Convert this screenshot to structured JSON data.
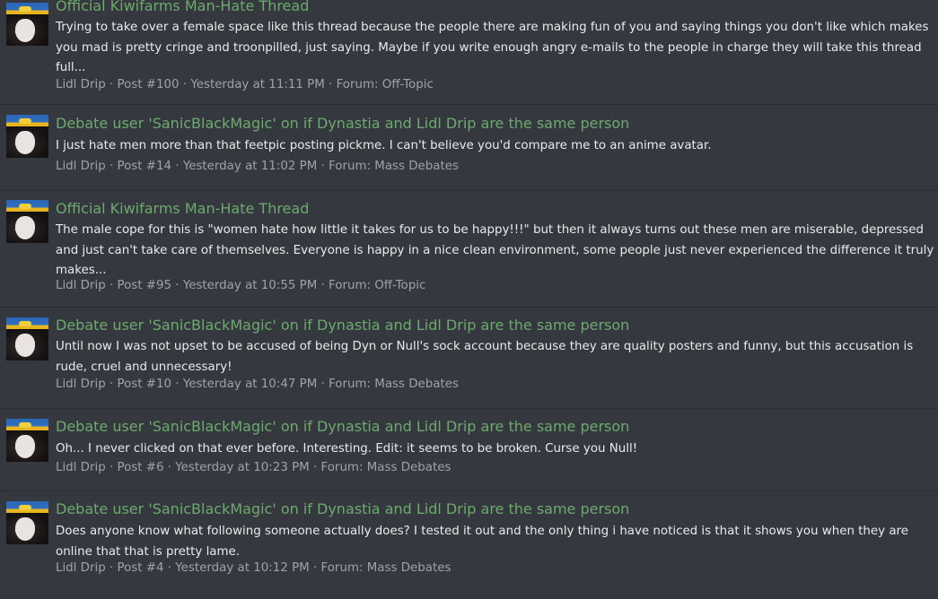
{
  "results": [
    {
      "title": "Official Kiwifarms Man-Hate Thread",
      "snippet": "Trying to take over a female space like this thread because the people there are making fun of you and saying things you don't like which makes you mad is pretty cringe and troonpilled, just saying. Maybe if you write enough angry e-mails to the people in charge they will take this thread full...",
      "author": "Lidl Drip",
      "post": "Post #100",
      "time": "Yesterday at 11:11 PM",
      "forum": "Forum: Off-Topic"
    },
    {
      "title": "Debate user 'SanicBlackMagic' on if Dynastia and Lidl Drip are the same person",
      "snippet": "I just hate men more than that feetpic posting pickme. I can't believe you'd compare me to an anime avatar.",
      "author": "Lidl Drip",
      "post": "Post #14",
      "time": "Yesterday at 11:02 PM",
      "forum": "Forum: Mass Debates"
    },
    {
      "title": "Official Kiwifarms Man-Hate Thread",
      "snippet": "The male cope for this is \"women hate how little it takes for us to be happy!!!\" but then it always turns out these men are miserable, depressed and just can't take care of themselves. Everyone is happy in a nice clean environment, some people just never experienced the difference it truly makes...",
      "author": "Lidl Drip",
      "post": "Post #95",
      "time": "Yesterday at 10:55 PM",
      "forum": "Forum: Off-Topic"
    },
    {
      "title": "Debate user 'SanicBlackMagic' on if Dynastia and Lidl Drip are the same person",
      "snippet": "Until now I was not upset to be accused of being Dyn or Null's sock account because they are quality posters and funny, but this accusation is rude, cruel and unnecessary!",
      "author": "Lidl Drip",
      "post": "Post #10",
      "time": "Yesterday at 10:47 PM",
      "forum": "Forum: Mass Debates"
    },
    {
      "title": "Debate user 'SanicBlackMagic' on if Dynastia and Lidl Drip are the same person",
      "snippet": "Oh... I never clicked on that ever before. Interesting. Edit: it seems to be broken. Curse you Null!",
      "author": "Lidl Drip",
      "post": "Post #6",
      "time": "Yesterday at 10:23 PM",
      "forum": "Forum: Mass Debates"
    },
    {
      "title": "Debate user 'SanicBlackMagic' on if Dynastia and Lidl Drip are the same person",
      "snippet": "Does anyone know what following someone actually does? I tested it out and the only thing i have noticed is that it shows you when they are online that that is pretty lame.",
      "author": "Lidl Drip",
      "post": "Post #4",
      "time": "Yesterday at 10:12 PM",
      "forum": "Forum: Mass Debates"
    }
  ],
  "meta_separator": " · "
}
